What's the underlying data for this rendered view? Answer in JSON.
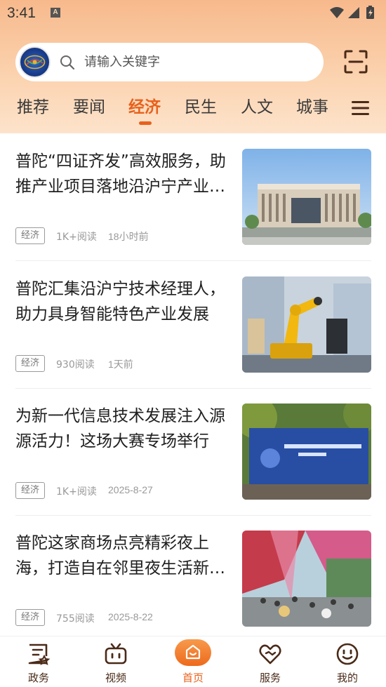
{
  "status": {
    "time": "3:41",
    "notif_glyph": "A"
  },
  "search": {
    "placeholder": "请输入关键字"
  },
  "tabs": [
    {
      "label": "推荐"
    },
    {
      "label": "要闻"
    },
    {
      "label": "经济",
      "active": true
    },
    {
      "label": "民生"
    },
    {
      "label": "人文"
    },
    {
      "label": "城事"
    }
  ],
  "articles": [
    {
      "title": "普陀“四证齐发”高效服务，助推产业项目落地沿沪宁产业创新带",
      "tag": "经济",
      "reads": "1K+阅读",
      "time": "18小时前",
      "image": "modern-building-photo"
    },
    {
      "title": "普陀汇集沿沪宁技术经理人，助力具身智能特色产业发展",
      "tag": "经济",
      "reads": "930阅读",
      "time": "1天前",
      "image": "yellow-robot-arm-photo"
    },
    {
      "title": "为新一代信息技术发展注入源源活力！这场大赛专场举行",
      "tag": "经济",
      "reads": "1K+阅读",
      "time": "2025-8-27",
      "image": "contest-stage-photo"
    },
    {
      "title": "普陀这家商场点亮精彩夜上海，打造自在邻里夜生活新场景",
      "tag": "经济",
      "reads": "755阅读",
      "time": "2025-8-22",
      "image": "mall-night-crowd-photo"
    }
  ],
  "nav": [
    {
      "label": "政务",
      "icon": "gov-doc-icon"
    },
    {
      "label": "视频",
      "icon": "tv-icon"
    },
    {
      "label": "首页",
      "icon": "home-icon",
      "active": true
    },
    {
      "label": "服务",
      "icon": "heart-service-icon"
    },
    {
      "label": "我的",
      "icon": "smiley-icon"
    }
  ],
  "colors": {
    "accent": "#e8611c",
    "header_top": "#f7b98c",
    "header_bottom": "#fde3cb",
    "nav_text": "#4a2a18"
  }
}
